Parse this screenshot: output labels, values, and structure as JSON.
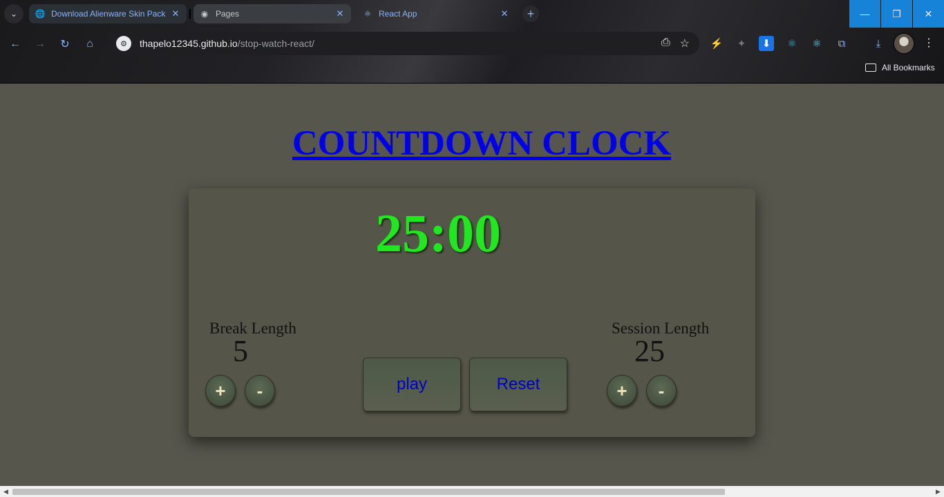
{
  "browser": {
    "tabs": [
      {
        "title": "Download Alienware Skin Pack",
        "icon": "globe-icon"
      },
      {
        "title": "Pages",
        "icon": "github-icon"
      },
      {
        "title": "React App",
        "icon": "react-icon"
      }
    ],
    "url_host": "thapelo12345.github.io",
    "url_path": "/stop-watch-react/",
    "bookmarks_label": "All Bookmarks"
  },
  "app": {
    "title": "COUNTDOWN CLOCK",
    "timer": "25:00",
    "break": {
      "label": "Break Length",
      "value": "5",
      "inc": "+",
      "dec": "-"
    },
    "session": {
      "label": "Session Length",
      "value": "25",
      "inc": "+",
      "dec": "-"
    },
    "play_label": "play",
    "reset_label": "Reset"
  },
  "colors": {
    "timer": "#1ee81e",
    "title_link": "#0000ee",
    "button_text": "#0000cc",
    "background": "#56564c"
  }
}
